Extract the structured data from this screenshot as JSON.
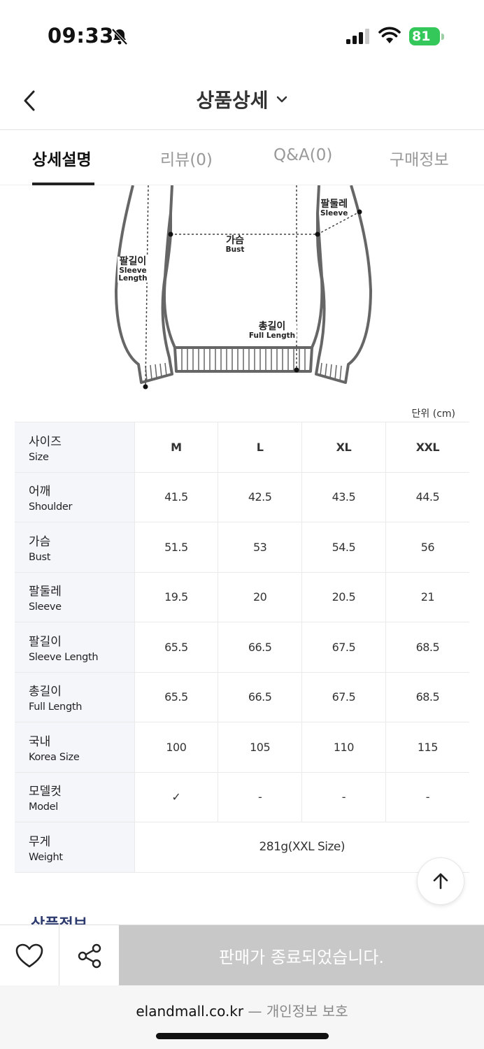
{
  "status_bar": {
    "time": "09:33",
    "battery": "81"
  },
  "header": {
    "title": "상품상세"
  },
  "tabs": [
    {
      "label": "상세설명"
    },
    {
      "label": "리뷰(0)"
    },
    {
      "label": "Q&A(0)"
    },
    {
      "label": "구매정보"
    }
  ],
  "diagram": {
    "sleeve": {
      "ko": "팔둘레",
      "en": "Sleeve"
    },
    "bust": {
      "ko": "가슴",
      "en": "Bust"
    },
    "sleeve_length": {
      "ko": "팔길이",
      "en1": "Sleeve",
      "en2": "Length"
    },
    "full_length": {
      "ko": "총길이",
      "en": "Full Length"
    }
  },
  "size_table": {
    "unit": "단위 (cm)",
    "rows": [
      {
        "ko": "사이즈",
        "en": "Size",
        "values": [
          "M",
          "L",
          "XL",
          "XXL"
        ]
      },
      {
        "ko": "어깨",
        "en": "Shoulder",
        "values": [
          "41.5",
          "42.5",
          "43.5",
          "44.5"
        ]
      },
      {
        "ko": "가슴",
        "en": "Bust",
        "values": [
          "51.5",
          "53",
          "54.5",
          "56"
        ]
      },
      {
        "ko": "팔둘레",
        "en": "Sleeve",
        "values": [
          "19.5",
          "20",
          "20.5",
          "21"
        ]
      },
      {
        "ko": "팔길이",
        "en": "Sleeve Length",
        "values": [
          "65.5",
          "66.5",
          "67.5",
          "68.5"
        ]
      },
      {
        "ko": "총길이",
        "en": "Full Length",
        "values": [
          "65.5",
          "66.5",
          "67.5",
          "68.5"
        ]
      },
      {
        "ko": "국내",
        "en": "Korea Size",
        "values": [
          "100",
          "105",
          "110",
          "115"
        ]
      },
      {
        "ko": "모델컷",
        "en": "Model",
        "values": [
          "✓",
          "-",
          "-",
          "-"
        ]
      },
      {
        "ko": "무게",
        "en": "Weight",
        "values": [
          "281g(XXL Size)"
        ]
      }
    ]
  },
  "section_peek": "상품정보",
  "action_bar": {
    "sold_out_label": "판매가 종료되었습니다."
  },
  "url_bar": {
    "domain": "elandmall.co.kr",
    "separator": "—",
    "extra": "개인정보 보호"
  },
  "icons": {
    "back": "chevron-left-icon",
    "title_dropdown": "chevron-down-icon",
    "wish": "heart-icon",
    "share": "share-icon",
    "scroll_top": "arrow-up-icon"
  }
}
